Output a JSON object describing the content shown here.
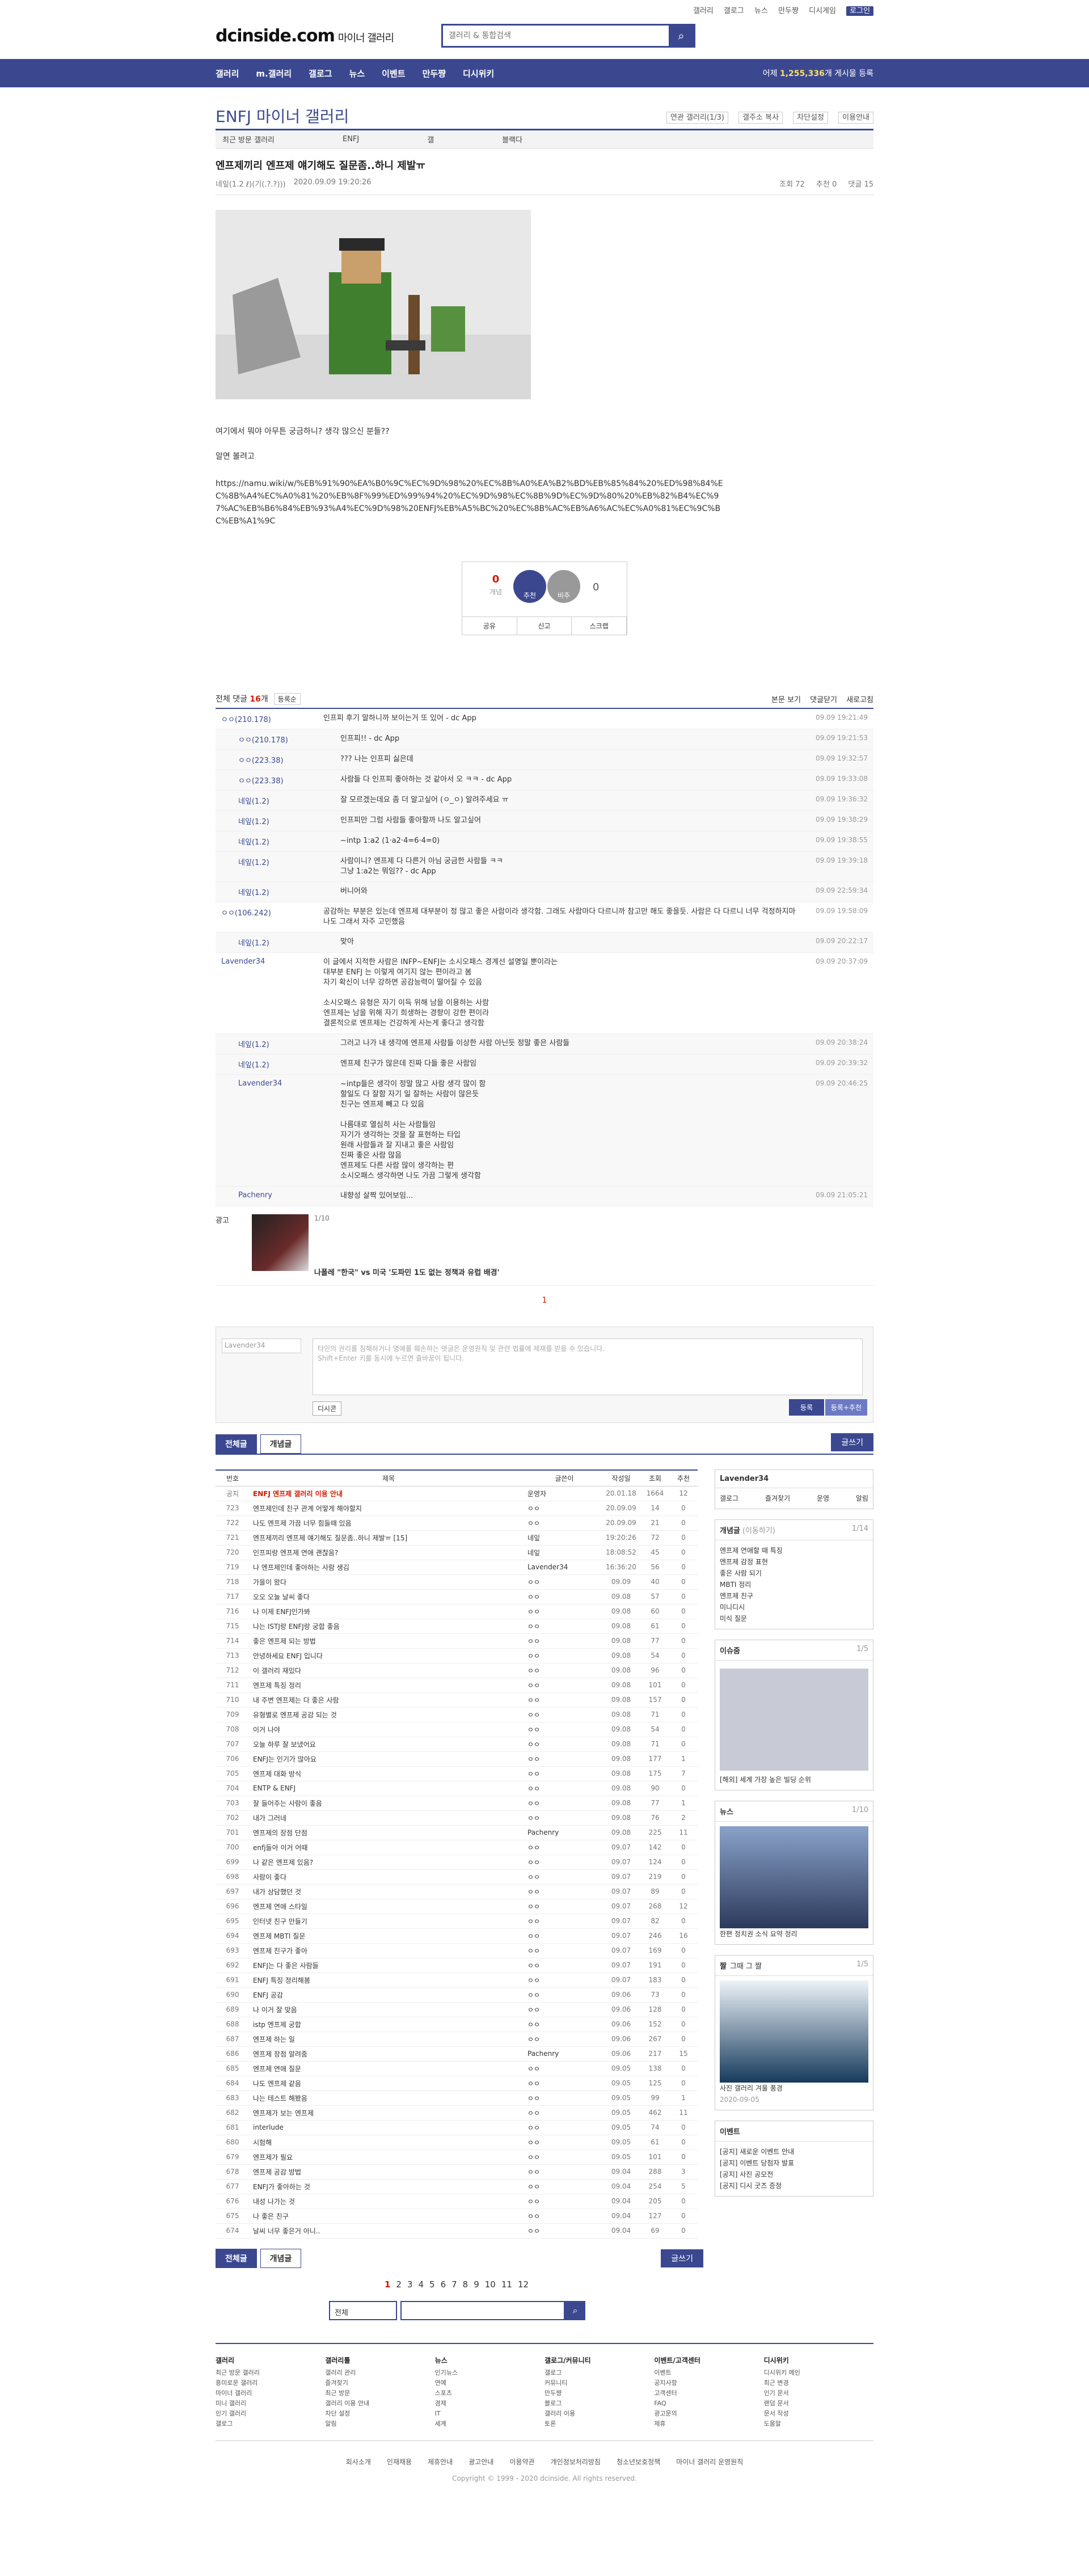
{
  "topnav": [
    "갤러리",
    "갤로그",
    "뉴스",
    "만두쨩",
    "디시게임",
    "로그인"
  ],
  "logo": {
    "main": "dcinside.com",
    "sub": "마이너 갤러리"
  },
  "search": {
    "placeholder": "갤러리 & 통합검색"
  },
  "gnb": {
    "items": [
      "갤러리",
      "m.갤러리",
      "갤로그",
      "뉴스",
      "이벤트",
      "만두쨩",
      "디시위키"
    ],
    "right_prefix": "어제 ",
    "right_count": "1,255,336",
    "right_suffix": "개 게시물 등록"
  },
  "gallery": {
    "title": "ENFJ 마이너 갤러리",
    "icons": [
      "연관 갤러리(1/3)",
      "갤주소 복사",
      "차단설정",
      "이용안내"
    ]
  },
  "relbar": [
    "최근 방문 갤러리",
    "ENFJ",
    "갤",
    "블랙다"
  ],
  "post": {
    "title": "엔프제끼리 엔프제 얘기해도 질문좀..하니 제발ㅠ",
    "author": "네잎(1.2 ℓ)(기(.?.?)))",
    "date": "2020.09.09 19:20:26",
    "views": "조회 72",
    "recommend": "추천 0",
    "comments": "댓글 15",
    "body": "여기에서 뭐야 아무튼 궁금하니? 생각 많으신 분들??\n\n알면 볼려고",
    "url": "https://namu.wiki/w/%EB%91%90%EA%B0%9C%EC%9D%98%20%EC%8B%A0%EA%B2%BD%EB%85%84%20%ED%98%84%EC%8B%A4%EC%A0%81%20%EB%8F%99%ED%99%94%20%EC%9D%98%EC%8B%9D%EC%9D%80%20%EB%82%B4%EC%97%AC%EB%B6%84%EB%93%A4%EC%9D%98%20ENFJ%EB%A5%BC%20%EC%8B%AC%EB%A6%AC%EC%A0%81%EC%9C%BC%EB%A1%9C"
  },
  "vote": {
    "up": "0",
    "up_label": "개념",
    "rec": "추천",
    "down_btn": "비추",
    "down": "0",
    "btns": [
      "공유",
      "신고",
      "스크랩"
    ]
  },
  "comment_head": {
    "label": "전체 댓글 ",
    "count": "16",
    "suffix": "개",
    "sort": "등록순",
    "r1": "본문 보기",
    "r2": "댓글닫기",
    "r3": "새로고침"
  },
  "comments": [
    {
      "reply": false,
      "nick": "ㅇㅇ(210.178)",
      "text": "인프피 후기 말하니까 보이는거 또 있어 - dc App",
      "date": "09.09 19:21:49"
    },
    {
      "reply": true,
      "nick": "ㅇㅇ(210.178)",
      "text": "인프피!! - dc App",
      "date": "09.09 19:21:53"
    },
    {
      "reply": true,
      "nick": "ㅇㅇ(223.38)",
      "text": "??? 나는 인프피 싫은데",
      "date": "09.09 19:32:57"
    },
    {
      "reply": true,
      "nick": "ㅇㅇ(223.38)",
      "text": "사람들 다 인프피 좋아하는 것 같아서 오 ㅋㅋ - dc App",
      "date": "09.09 19:33:08"
    },
    {
      "reply": true,
      "nick": "네잎(1.2)",
      "text": "잘 모르겠는데요 좀 더 알고싶어 (ㅇ_ㅇ) 알려주세요 ㅠ",
      "date": "09.09 19:36:32"
    },
    {
      "reply": true,
      "nick": "네잎(1.2)",
      "text": "인프피만 그럼 사람들 좋아할까 나도 알고싶어",
      "date": "09.09 19:38:29"
    },
    {
      "reply": true,
      "nick": "네잎(1.2)",
      "text": "~intp 1:a2 (1·a2·4=6·4=0)",
      "date": "09.09 19:38:55"
    },
    {
      "reply": true,
      "nick": "네잎(1.2)",
      "text": "사람이니? 엔프제 다 다른거 아님 궁금한 사람들 ㅋㅋ\n그냥 1:a2는 뭐임?? - dc App",
      "date": "09.09 19:39:18"
    },
    {
      "reply": true,
      "nick": "네잎(1.2)",
      "text": "버니어와",
      "date": "09.09 22:59:34"
    },
    {
      "reply": false,
      "nick": "ㅇㅇ(106.242)",
      "text": "공감하는 부분은 있는데 엔프제 대부분이 정 많고 좋은 사람이라 생각함. 그래도 사람마다 다르니까 참고만 해도 좋을듯. 사람은 다 다르니 너무 걱정하지마 나도 그래서 자주 고민했음",
      "date": "09.09 19:58:09"
    },
    {
      "reply": true,
      "nick": "네잎(1.2)",
      "text": "맞아",
      "date": "09.09 20:22:17"
    },
    {
      "reply": false,
      "nick": "Lavender34",
      "text": "이 글에서 지적한 사람은 INFP~ENFJ는 소시오패스 경계선 설명일 뿐이라는\n대부분 ENFJ 는 이렇게 여기지 않는 편이라고 봄\n자기 확신이 너무 강하면 공감능력이 떨어질 수 있음\n\n소시오패스 유형은 자기 이득 위해 남을 이용하는 사람\n엔프제는 남을 위해 자기 희생하는 경향이 강한 편이라\n결론적으로 엔프제는 건강하게 사는게 좋다고 생각함",
      "date": "09.09 20:37:09"
    },
    {
      "reply": true,
      "nick": "네잎(1.2)",
      "text": "그러고 나가 내 생각에 엔프제 사람들 이상한 사람 아닌듯 정말 좋은 사람들",
      "date": "09.09 20:38:24"
    },
    {
      "reply": true,
      "nick": "네잎(1.2)",
      "text": "엔프제 친구가 많은데 진짜 다들 좋은 사람임",
      "date": "09.09 20:39:32"
    },
    {
      "reply": true,
      "nick": "Lavender34",
      "text": "~intp들은 생각이 정말 많고 사람 생각 많이 함\n할일도 다 잘함 자기 일 잘하는 사람이 많은듯\n친구는 엔프제 빼고 다 있음\n\n나름대로 열심히 사는 사람들임\n자기가 생각하는 것을 잘 표현하는 타입\n원래 사람들과 잘 지내고 좋은 사람임\n진짜 좋은 사람 많음\n엔프제도 다른 사람 많이 생각하는 편\n소시오패스 생각하면 나도 가끔 그렇게 생각함",
      "date": "09.09 20:46:25"
    },
    {
      "reply": true,
      "nick": "Pachenry",
      "text": "내향성 살짝 있어보임...",
      "date": "09.09 21:05:21"
    }
  ],
  "ad": {
    "page": "1/10",
    "text": "나폴레 \"한국\" vs 미국 '도파민 1도 없는 정책과 유럽 배경'"
  },
  "pager1": "1",
  "write": {
    "nick_placeholder": "Lavender34",
    "textarea": "타인의 권리를 침해하거나 명예를 훼손하는 댓글은 운영원칙 및 관련 법률에 제재를 받을 수 있습니다.\nShift+Enter 키를 동시에 누르면 줄바꿈이 됩니다.",
    "dccon": "디시콘",
    "reg": "등록",
    "reg2": "등록+추천"
  },
  "tabs": {
    "all": "전체글",
    "good": "개념글",
    "write": "글쓰기"
  },
  "list_header": [
    "번호",
    "제목",
    "글쓴이",
    "작성일",
    "조회",
    "추천"
  ],
  "list_rows": [
    {
      "n": "공지",
      "s": "ENFJ 엔프제 갤러리 이용 안내",
      "w": "운영자",
      "d": "20.01.18",
      "v": "1664",
      "r": "12",
      "notice": true
    },
    {
      "n": "723",
      "s": "엔프제인데 친구 관계 어떻게 해야할지",
      "w": "ㅇㅇ",
      "d": "20.09.09",
      "v": "14",
      "r": "0"
    },
    {
      "n": "722",
      "s": "나도 엔프제 가끔 너무 힘들때 있음",
      "w": "ㅇㅇ",
      "d": "20.09.09",
      "v": "21",
      "r": "0"
    },
    {
      "n": "721",
      "s": "엔프제끼리 엔프제 얘기해도 질문좀..하니 제발ㅠ [15]",
      "w": "네잎",
      "d": "19:20:26",
      "v": "72",
      "r": "0"
    },
    {
      "n": "720",
      "s": "인프피랑 엔프제 연애 괜찮음?",
      "w": "네잎",
      "d": "18:08:52",
      "v": "45",
      "r": "0"
    },
    {
      "n": "719",
      "s": "나 엔프제인데 좋아하는 사람 생김",
      "w": "Lavender34",
      "d": "16:36:20",
      "v": "56",
      "r": "0"
    },
    {
      "n": "718",
      "s": "가을이 왔다",
      "w": "ㅇㅇ",
      "d": "09.09",
      "v": "40",
      "r": "0"
    },
    {
      "n": "717",
      "s": "오오 오늘 날씨 좋다",
      "w": "ㅇㅇ",
      "d": "09.08",
      "v": "57",
      "r": "0"
    },
    {
      "n": "716",
      "s": "나 이제 ENFJ인가봐",
      "w": "ㅇㅇ",
      "d": "09.08",
      "v": "60",
      "r": "0"
    },
    {
      "n": "715",
      "s": "나는 ISTJ랑 ENFJ랑 궁합 좋음",
      "w": "ㅇㅇ",
      "d": "09.08",
      "v": "61",
      "r": "0"
    },
    {
      "n": "714",
      "s": "좋은 엔프제 되는 방법",
      "w": "ㅇㅇ",
      "d": "09.08",
      "v": "77",
      "r": "0"
    },
    {
      "n": "713",
      "s": "안녕하세요 ENFJ 입니다",
      "w": "ㅇㅇ",
      "d": "09.08",
      "v": "54",
      "r": "0"
    },
    {
      "n": "712",
      "s": "이 갤러리 재밌다",
      "w": "ㅇㅇ",
      "d": "09.08",
      "v": "96",
      "r": "0"
    },
    {
      "n": "711",
      "s": "엔프제 특징 정리",
      "w": "ㅇㅇ",
      "d": "09.08",
      "v": "101",
      "r": "0"
    },
    {
      "n": "710",
      "s": "내 주변 엔프제는 다 좋은 사람",
      "w": "ㅇㅇ",
      "d": "09.08",
      "v": "157",
      "r": "0"
    },
    {
      "n": "709",
      "s": "유형별로 엔프제 공감 되는 것",
      "w": "ㅇㅇ",
      "d": "09.08",
      "v": "71",
      "r": "0"
    },
    {
      "n": "708",
      "s": "이거 나야",
      "w": "ㅇㅇ",
      "d": "09.08",
      "v": "54",
      "r": "0"
    },
    {
      "n": "707",
      "s": "오늘 하루 잘 보냈어요",
      "w": "ㅇㅇ",
      "d": "09.08",
      "v": "71",
      "r": "0"
    },
    {
      "n": "706",
      "s": "ENFJ는 인기가 많아요",
      "w": "ㅇㅇ",
      "d": "09.08",
      "v": "177",
      "r": "1"
    },
    {
      "n": "705",
      "s": "엔프제 대화 방식",
      "w": "ㅇㅇ",
      "d": "09.08",
      "v": "175",
      "r": "7"
    },
    {
      "n": "704",
      "s": "ENTP & ENFJ",
      "w": "ㅇㅇ",
      "d": "09.08",
      "v": "90",
      "r": "0"
    },
    {
      "n": "703",
      "s": "잘 들어주는 사람이 좋음",
      "w": "ㅇㅇ",
      "d": "09.08",
      "v": "77",
      "r": "1"
    },
    {
      "n": "702",
      "s": "내가 그러네",
      "w": "ㅇㅇ",
      "d": "09.08",
      "v": "76",
      "r": "2"
    },
    {
      "n": "701",
      "s": "엔프제의 장점 단점",
      "w": "Pachenry",
      "d": "09.08",
      "v": "225",
      "r": "11"
    },
    {
      "n": "700",
      "s": "enfj들아 이거 어때",
      "w": "ㅇㅇ",
      "d": "09.07",
      "v": "142",
      "r": "0"
    },
    {
      "n": "699",
      "s": "나 같은 엔프제 있음?",
      "w": "ㅇㅇ",
      "d": "09.07",
      "v": "124",
      "r": "0"
    },
    {
      "n": "698",
      "s": "사람이 좋다",
      "w": "ㅇㅇ",
      "d": "09.07",
      "v": "219",
      "r": "0"
    },
    {
      "n": "697",
      "s": "내가 상담했던 것",
      "w": "ㅇㅇ",
      "d": "09.07",
      "v": "89",
      "r": "0"
    },
    {
      "n": "696",
      "s": "엔프제 연애 스타일",
      "w": "ㅇㅇ",
      "d": "09.07",
      "v": "268",
      "r": "12"
    },
    {
      "n": "695",
      "s": "인터넷 친구 만들기",
      "w": "ㅇㅇ",
      "d": "09.07",
      "v": "82",
      "r": "0"
    },
    {
      "n": "694",
      "s": "엔프제 MBTI 질문",
      "w": "ㅇㅇ",
      "d": "09.07",
      "v": "246",
      "r": "16"
    },
    {
      "n": "693",
      "s": "엔프제 친구가 좋아",
      "w": "ㅇㅇ",
      "d": "09.07",
      "v": "169",
      "r": "0"
    },
    {
      "n": "692",
      "s": "ENFJ는 다 좋은 사람들",
      "w": "ㅇㅇ",
      "d": "09.07",
      "v": "191",
      "r": "0"
    },
    {
      "n": "691",
      "s": "ENFJ 특징 정리해봄",
      "w": "ㅇㅇ",
      "d": "09.07",
      "v": "183",
      "r": "0"
    },
    {
      "n": "690",
      "s": "ENFJ 공감",
      "w": "ㅇㅇ",
      "d": "09.06",
      "v": "73",
      "r": "0"
    },
    {
      "n": "689",
      "s": "나 이거 잘 맞음",
      "w": "ㅇㅇ",
      "d": "09.06",
      "v": "128",
      "r": "0"
    },
    {
      "n": "688",
      "s": "istp 엔프제 궁합",
      "w": "ㅇㅇ",
      "d": "09.06",
      "v": "152",
      "r": "0"
    },
    {
      "n": "687",
      "s": "엔프제 하는 일",
      "w": "ㅇㅇ",
      "d": "09.06",
      "v": "267",
      "r": "0"
    },
    {
      "n": "686",
      "s": "엔프제 장점 알려줌",
      "w": "Pachenry",
      "d": "09.06",
      "v": "217",
      "r": "15"
    },
    {
      "n": "685",
      "s": "엔프제 연애 질문",
      "w": "ㅇㅇ",
      "d": "09.05",
      "v": "138",
      "r": "0"
    },
    {
      "n": "684",
      "s": "나도 엔프제 같음",
      "w": "ㅇㅇ",
      "d": "09.05",
      "v": "125",
      "r": "0"
    },
    {
      "n": "683",
      "s": "나는 테스트 해봤음",
      "w": "ㅇㅇ",
      "d": "09.05",
      "v": "99",
      "r": "1"
    },
    {
      "n": "682",
      "s": "엔프제가 보는 엔프제",
      "w": "ㅇㅇ",
      "d": "09.05",
      "v": "462",
      "r": "11"
    },
    {
      "n": "681",
      "s": "interlude",
      "w": "ㅇㅇ",
      "d": "09.05",
      "v": "74",
      "r": "0"
    },
    {
      "n": "680",
      "s": "시험해",
      "w": "ㅇㅇ",
      "d": "09.05",
      "v": "61",
      "r": "0"
    },
    {
      "n": "679",
      "s": "엔프제가 필요",
      "w": "ㅇㅇ",
      "d": "09.05",
      "v": "101",
      "r": "0"
    },
    {
      "n": "678",
      "s": "엔프제 공감 방법",
      "w": "ㅇㅇ",
      "d": "09.04",
      "v": "288",
      "r": "3"
    },
    {
      "n": "677",
      "s": "ENFJ가 좋아하는 것",
      "w": "ㅇㅇ",
      "d": "09.04",
      "v": "254",
      "r": "5"
    },
    {
      "n": "676",
      "s": "내성 나가는 것",
      "w": "ㅇㅇ",
      "d": "09.04",
      "v": "205",
      "r": "0"
    },
    {
      "n": "675",
      "s": "나 좋은 친구",
      "w": "ㅇㅇ",
      "d": "09.04",
      "v": "127",
      "r": "0"
    },
    {
      "n": "674",
      "s": "날씨 너무 좋은거 아니..",
      "w": "ㅇㅇ",
      "d": "09.04",
      "v": "69",
      "r": "0"
    }
  ],
  "side": {
    "user": {
      "name": "Lavender34",
      "btns": [
        "갤로그",
        "즐겨찾기",
        "운영",
        "알림"
      ]
    },
    "concept": {
      "title": "개념글",
      "sub": "(이동하기)",
      "page": "1/14",
      "items": [
        "엔프제 연애할 때 특징",
        "엔프제 감정 표현",
        "좋은 사람 되기",
        "MBTI 정리",
        "엔프제 친구",
        "미니디시",
        "미식 질문"
      ]
    },
    "issue": {
      "title": "이슈줌",
      "page": "1/5",
      "caption": "[해외] 세계 가장 높은 빌딩 순위"
    },
    "news": {
      "title": "뉴스",
      "page": "1/10",
      "caption": "한편 정치권 소식 요약 정리"
    },
    "zzal": {
      "title": "짤",
      "sub": "그때 그 짤",
      "page": "1/5",
      "caption": "사진 갤러리 겨울 풍경",
      "date": "2020-09-05"
    },
    "event": {
      "title": "이벤트",
      "items": [
        "[공지] 새로운 이벤트 안내",
        "[공지] 이벤트 당첨자 발표",
        "[공지] 사진 공모전",
        "[공지] 디시 굿즈 증정"
      ]
    }
  },
  "pages": [
    "1",
    "2",
    "3",
    "4",
    "5",
    "6",
    "7",
    "8",
    "9",
    "10",
    "11",
    "12"
  ],
  "bottom_search": {
    "select": "전체"
  },
  "sitemap": [
    {
      "h": "갤러리",
      "items": [
        "최근 방문 갤러리",
        "흥미로운 갤러리",
        "마이너 갤러리",
        "미니 갤러리",
        "인기 갤러리",
        "갤로그"
      ]
    },
    {
      "h": "갤러리툴",
      "items": [
        "갤러리 관리",
        "즐겨찾기",
        "최근 방문",
        "갤러리 이용 안내",
        "차단 설정",
        "알림"
      ]
    },
    {
      "h": "뉴스",
      "items": [
        "인기뉴스",
        "연예",
        "스포츠",
        "경제",
        "IT",
        "세계"
      ]
    },
    {
      "h": "갤로그/커뮤니티",
      "items": [
        "갤로그",
        "커뮤니티",
        "만두쨩",
        "블로그",
        "갤러리 이용",
        "토론"
      ]
    },
    {
      "h": "이벤트/고객센터",
      "items": [
        "이벤트",
        "공지사항",
        "고객센터",
        "FAQ",
        "광고문의",
        "제휴"
      ]
    },
    {
      "h": "디시위키",
      "items": [
        "디시위키 메인",
        "최근 변경",
        "인기 문서",
        "랜덤 문서",
        "문서 작성",
        "도움말"
      ]
    }
  ],
  "footer": {
    "links": [
      "회사소개",
      "인재채용",
      "제휴안내",
      "광고안내",
      "이용약관",
      "개인정보처리방침",
      "청소년보호정책",
      "마이너 갤러리 운영원칙"
    ],
    "copy": "Copyright © 1999 - 2020 dcinside. All rights reserved."
  }
}
